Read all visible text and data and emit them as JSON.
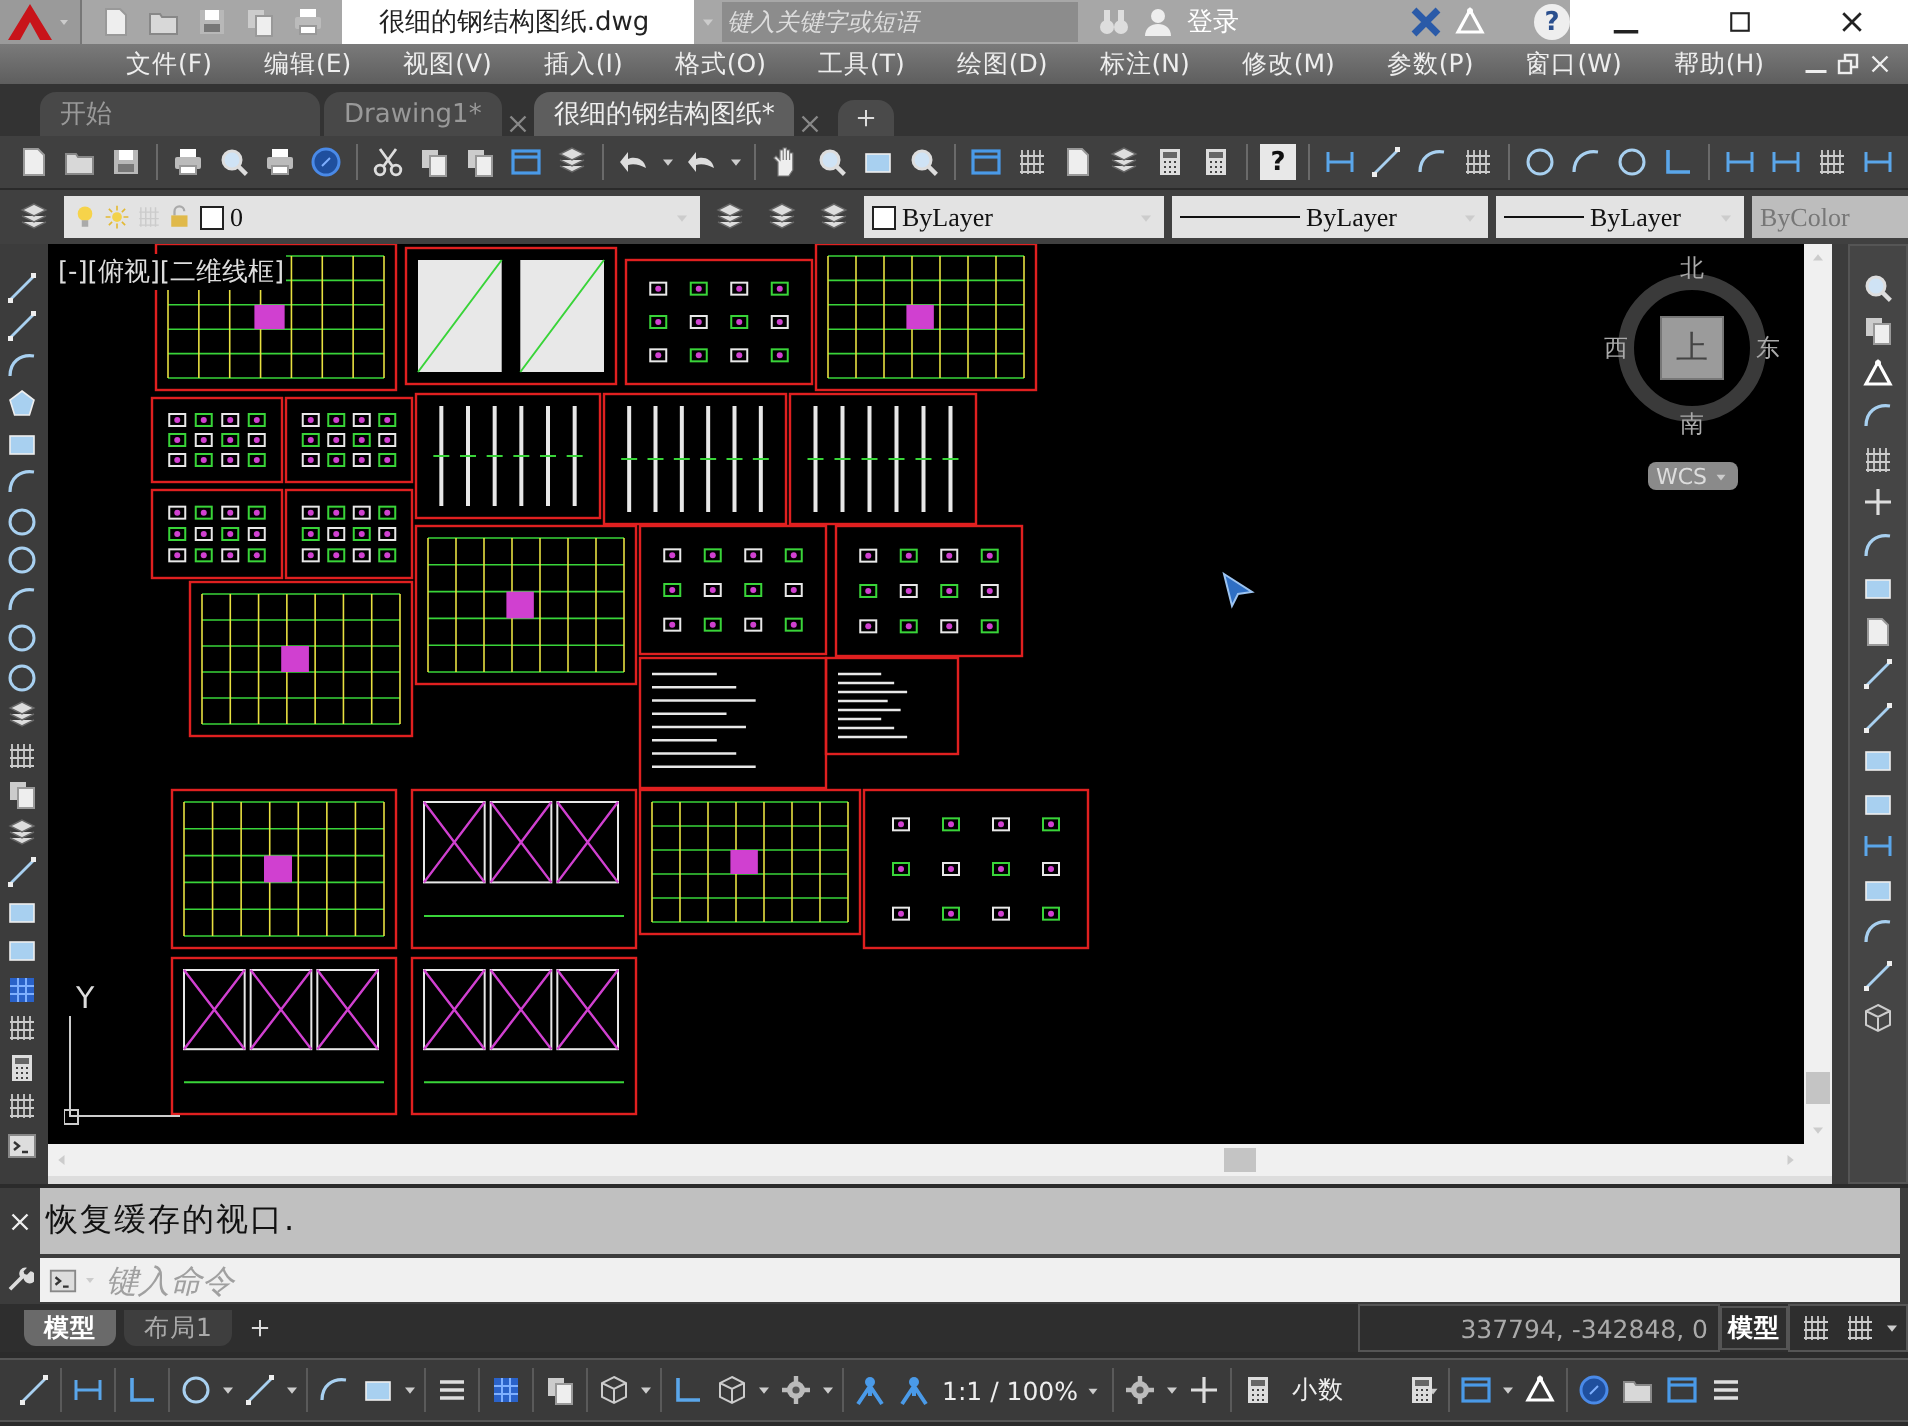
{
  "title_bar": {
    "document_title": "很细的钢结构图纸.dwg",
    "search": {
      "placeholder": "键入关键字或短语"
    },
    "sign_in": "登录",
    "help": "?"
  },
  "menu_bar": {
    "items": [
      "文件(F)",
      "编辑(E)",
      "视图(V)",
      "插入(I)",
      "格式(O)",
      "工具(T)",
      "绘图(D)",
      "标注(N)",
      "修改(M)",
      "参数(P)",
      "窗口(W)",
      "帮助(H)"
    ]
  },
  "document_tabs": [
    {
      "label": "开始",
      "selected": false,
      "closable": false
    },
    {
      "label": "Drawing1*",
      "selected": false,
      "closable": true
    },
    {
      "label": "很细的钢结构图纸*",
      "selected": true,
      "closable": true
    }
  ],
  "toolbar": {
    "help": "?"
  },
  "layer_bar": {
    "layer": "0",
    "color_control": "ByLayer",
    "linetype": "ByLayer",
    "lineweight": "ByLayer",
    "plot_style": {
      "value": "ByColor",
      "disabled": true
    }
  },
  "viewport": {
    "label": "[-][俯视][二维线框]",
    "compass": {
      "north": "北",
      "west": "西",
      "face": "上",
      "east": "东",
      "south": "南",
      "ucs": "WCS"
    },
    "ucs_axis": "Y"
  },
  "command_line": {
    "history": "恢复缓存的视口.",
    "placeholder": "键入命令"
  },
  "layout_tabs": [
    {
      "label": "模型",
      "selected": true
    },
    {
      "label": "布局1",
      "selected": false
    }
  ],
  "coordinates": "337794, -342848, 0",
  "space": "模型",
  "status_bar": {
    "scale": "1:1 / 100%",
    "units": "小数"
  }
}
